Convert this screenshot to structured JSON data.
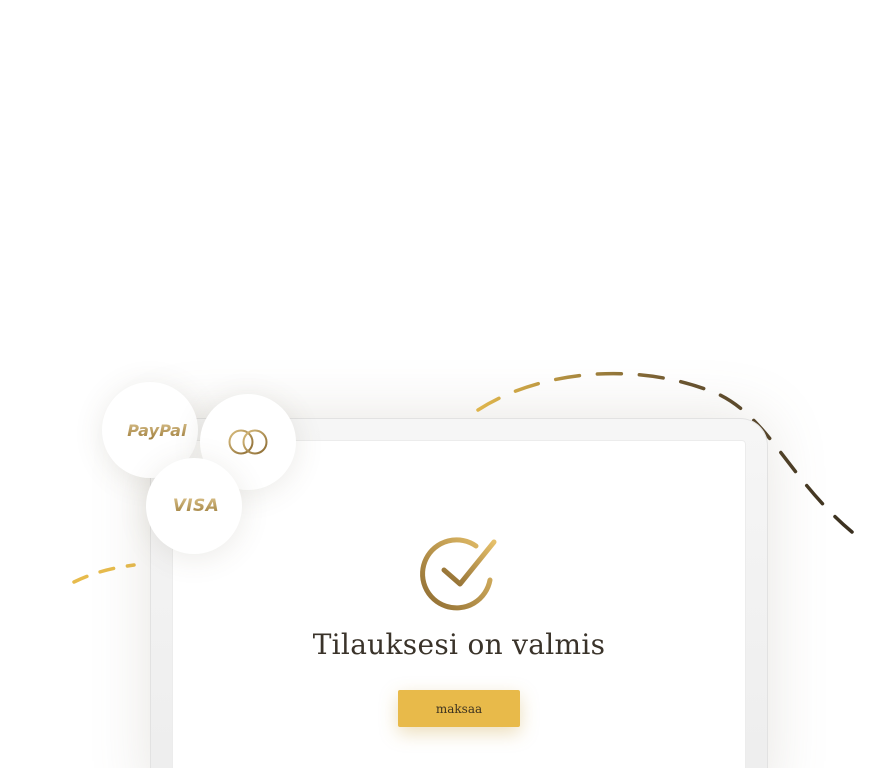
{
  "screen": {
    "title": "Tilauksesi on valmis",
    "button_label": "maksaa"
  },
  "payment_methods": {
    "paypal": "PayPal",
    "mastercard": "mastercard-icon",
    "visa": "VISA"
  },
  "icons": {
    "success": "check-circle-icon"
  },
  "colors": {
    "accent": "#e8ba4a",
    "gold_dark": "#8c6a30",
    "gold_light": "#e3c27a",
    "title": "#3a332a",
    "dash_dark": "#5a4a30"
  }
}
